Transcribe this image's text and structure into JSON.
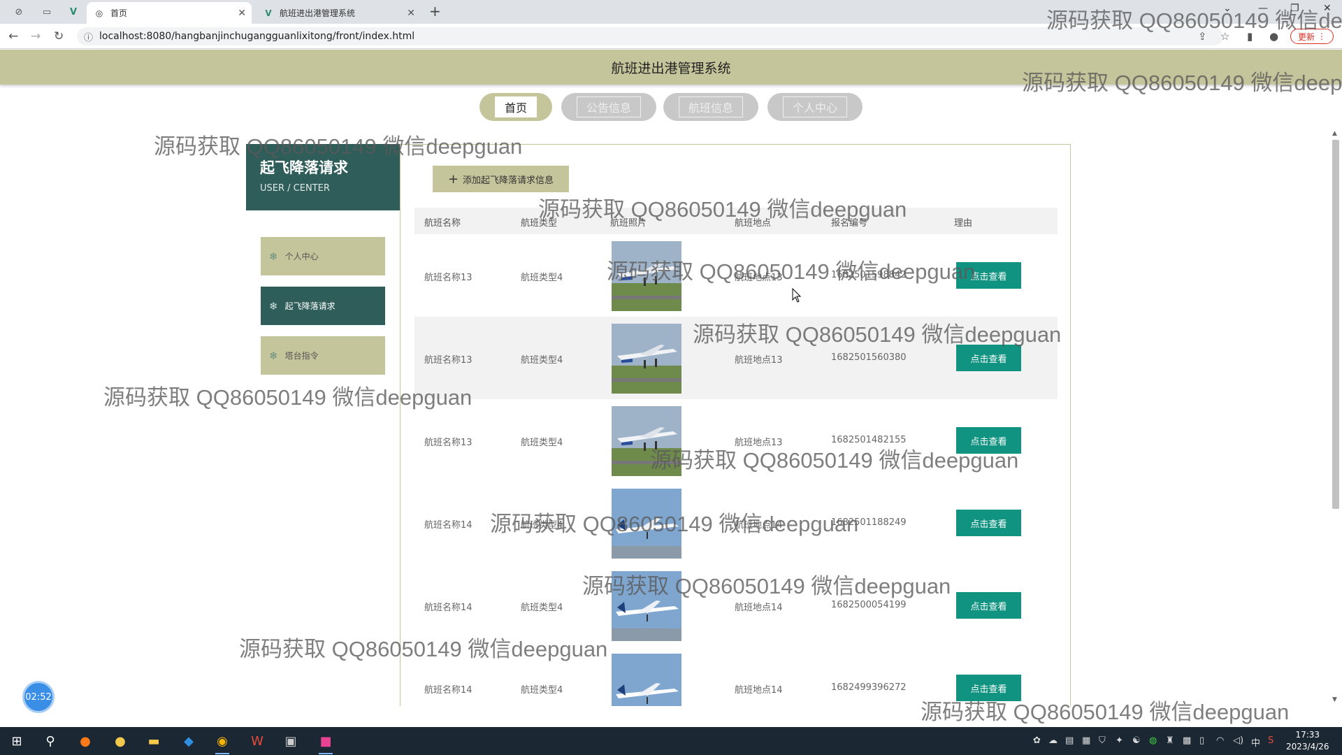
{
  "browser": {
    "tabs": [
      {
        "title": "首页",
        "active": true
      },
      {
        "title": "航班进出港管理系统",
        "active": false
      }
    ],
    "url": "localhost:8080/hangbanjinchugangguanlixitong/front/index.html",
    "update_label": "更新"
  },
  "site": {
    "title": "航班进出港管理系统",
    "nav": [
      "首页",
      "公告信息",
      "航班信息",
      "个人中心"
    ]
  },
  "sidebar": {
    "title": "起飞降落请求",
    "subtitle": "USER / CENTER",
    "items": [
      {
        "label": "个人中心",
        "active": false
      },
      {
        "label": "起飞降落请求",
        "active": true
      },
      {
        "label": "塔台指令",
        "active": false
      }
    ]
  },
  "main": {
    "add_button": "添加起飞降落请求信息",
    "columns": [
      "航班名称",
      "航班类型",
      "航班照片",
      "航班地点",
      "报名编号",
      "理由"
    ],
    "rows": [
      {
        "name": "航班名称13",
        "type": "航班类型4",
        "place": "航班地点13",
        "code": "1682501598842",
        "action": "点击查看"
      },
      {
        "name": "航班名称13",
        "type": "航班类型4",
        "place": "航班地点13",
        "code": "1682501560380",
        "action": "点击查看"
      },
      {
        "name": "航班名称13",
        "type": "航班类型4",
        "place": "航班地点13",
        "code": "1682501482155",
        "action": "点击查看"
      },
      {
        "name": "航班名称14",
        "type": "航班类型4",
        "place": "航班地点14",
        "code": "1682501188249",
        "action": "点击查看"
      },
      {
        "name": "航班名称14",
        "type": "航班类型4",
        "place": "航班地点14",
        "code": "1682500054199",
        "action": "点击查看"
      },
      {
        "name": "航班名称14",
        "type": "航班类型4",
        "place": "航班地点14",
        "code": "1682499396272",
        "action": "点击查看"
      }
    ]
  },
  "timer": "02:52",
  "taskbar": {
    "time": "17:33",
    "date": "2023/4/26",
    "ime": "中"
  },
  "watermark": "源码获取 QQ86050149 微信deepguan",
  "colors": {
    "header_olive": "#c5c59c",
    "sidebar_teal": "#2e5d5a",
    "button_teal": "#119381"
  }
}
